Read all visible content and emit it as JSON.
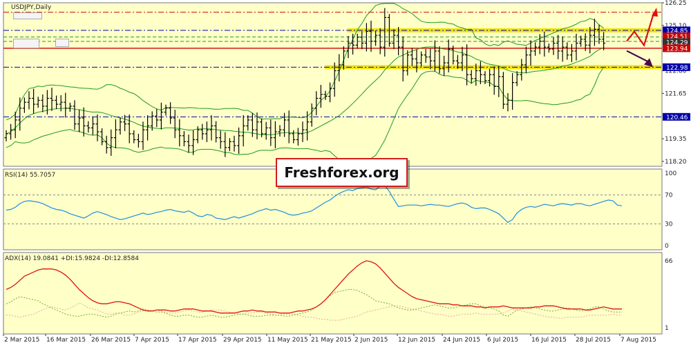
{
  "colors": {
    "background": "#ffffc8",
    "grid": "#d8d8a8",
    "candle": "#000000",
    "bollinger": "#1f9a1f",
    "rsi_line": "#1e8fe0",
    "adx_line": "#e01010",
    "di_plus": "#6fb02a",
    "di_minus": "#e6a8a8",
    "level_blue": "#0000aa",
    "level_red": "#cc0000",
    "zone_yellow": "#f0e000",
    "arrow_up": "#dd1010",
    "arrow_down": "#4b0a4b"
  },
  "header": {
    "symbol": "USDJPY,Daily"
  },
  "indicators": {
    "rsi_label": "RSI(14) 55.7057",
    "adx_label": "ADX(14) 19.0841 +DI:15.9824 -DI:12.8584"
  },
  "brand": {
    "text": "Freshforex.org"
  },
  "price_badges": [
    {
      "value": "124.85",
      "color": "#0000aa"
    },
    {
      "value": "124.51",
      "color": "#cc0000"
    },
    {
      "value": "124.29",
      "color": "#333333"
    },
    {
      "value": "123.94",
      "color": "#cc0000"
    },
    {
      "value": "122.98",
      "color": "#0000aa"
    },
    {
      "value": "120.46",
      "color": "#0000aa"
    }
  ],
  "chart_data": {
    "type": "candlestick",
    "title": "USDJPY,Daily",
    "x_tick_labels": [
      "2 Mar 2015",
      "16 Mar 2015",
      "26 Mar 2015",
      "7 Apr 2015",
      "17 Apr 2015",
      "29 Apr 2015",
      "11 May 2015",
      "21 May 2015",
      "2 Jun 2015",
      "12 Jun 2015",
      "24 Jun 2015",
      "6 Jul 2015",
      "16 Jul 2015",
      "28 Jul 2015",
      "7 Aug 2015"
    ],
    "price_axis": {
      "ylim": [
        117.95,
        126.25
      ],
      "tick_labels": [
        "126.25",
        "125.10",
        "122.80",
        "121.65",
        "119.35",
        "118.20"
      ]
    },
    "ohlc_close_estimates": [
      119.6,
      119.8,
      120.3,
      120.9,
      121.2,
      121.4,
      121.1,
      121.3,
      121.0,
      121.4,
      121.3,
      121.1,
      121.2,
      120.9,
      121.0,
      120.1,
      120.4,
      120.0,
      119.9,
      120.1,
      119.7,
      119.2,
      118.9,
      119.4,
      119.8,
      120.2,
      120.1,
      119.6,
      119.3,
      119.2,
      119.8,
      120.0,
      120.5,
      120.3,
      120.7,
      120.9,
      120.4,
      119.8,
      119.5,
      119.2,
      119.0,
      119.3,
      119.8,
      119.6,
      119.8,
      120.0,
      119.4,
      119.2,
      118.9,
      119.2,
      119.0,
      119.5,
      120.0,
      120.3,
      119.8,
      120.2,
      119.6,
      119.9,
      119.4,
      119.7,
      119.8,
      120.3,
      119.6,
      119.3,
      119.6,
      119.8,
      120.2,
      120.9,
      121.4,
      121.6,
      121.5,
      121.9,
      122.8,
      123.1,
      123.8,
      124.2,
      124.1,
      124.5,
      124.2,
      124.8,
      124.3,
      124.6,
      124.0,
      125.5,
      124.2,
      124.6,
      124.0,
      122.8,
      123.6,
      123.4,
      123.2,
      123.6,
      123.5,
      123.3,
      123.8,
      122.9,
      123.2,
      123.9,
      123.3,
      123.2,
      123.6,
      122.6,
      122.4,
      122.8,
      122.6,
      122.3,
      122.6,
      122.0,
      122.5,
      121.1,
      121.3,
      122.2,
      122.6,
      123.1,
      123.6,
      123.8,
      124.0,
      124.3,
      124.0,
      123.9,
      124.2,
      123.8,
      124.0,
      123.6,
      123.8,
      124.2,
      124.4,
      124.1,
      124.6,
      124.9,
      124.4,
      124.2
    ],
    "reference_levels": [
      {
        "price": 125.77,
        "style": "dash-dot",
        "color": "#cc0000"
      },
      {
        "price": 124.85,
        "style": "dash-dot",
        "color": "#0000aa"
      },
      {
        "price": 124.51,
        "style": "dash",
        "color": "#1f9a1f"
      },
      {
        "price": 124.29,
        "style": "dash",
        "color": "#1f9a1f"
      },
      {
        "price": 123.94,
        "style": "solid",
        "color": "#cc0000"
      },
      {
        "price": 122.98,
        "style": "dash-dot",
        "color": "#0000aa"
      },
      {
        "price": 120.46,
        "style": "dash-dot",
        "color": "#0000aa"
      }
    ],
    "rsi": {
      "label": "RSI(14) 55.7057",
      "ylim": [
        0,
        100
      ],
      "tick_labels": [
        "100",
        "70",
        "30",
        "0"
      ],
      "levels": [
        70,
        30
      ],
      "values": [
        49,
        50,
        53,
        58,
        61,
        62,
        61,
        60,
        58,
        55,
        52,
        50,
        49,
        47,
        44,
        42,
        40,
        38,
        41,
        45,
        47,
        45,
        43,
        40,
        38,
        36,
        37,
        39,
        41,
        43,
        45,
        43,
        44,
        46,
        47,
        49,
        50,
        48,
        47,
        46,
        48,
        45,
        41,
        40,
        43,
        42,
        38,
        37,
        36,
        38,
        40,
        38,
        40,
        42,
        44,
        47,
        49,
        51,
        49,
        50,
        48,
        46,
        43,
        42,
        43,
        45,
        46,
        48,
        52,
        56,
        60,
        63,
        68,
        72,
        75,
        77,
        76,
        79,
        80,
        81,
        78,
        77,
        82,
        83,
        75,
        64,
        54,
        55,
        56,
        56,
        56,
        55,
        56,
        57,
        56,
        56,
        55,
        54,
        56,
        58,
        59,
        57,
        53,
        51,
        52,
        52,
        50,
        47,
        44,
        38,
        32,
        36,
        45,
        50,
        53,
        54,
        53,
        55,
        57,
        56,
        55,
        57,
        58,
        57,
        56,
        58,
        58,
        56,
        55,
        57,
        59,
        61,
        63,
        62,
        56,
        55
      ]
    },
    "adx": {
      "label": "ADX(14) 19.0841 +DI:15.9824 -DI:12.8584",
      "tick_labels": [
        "66",
        "1"
      ],
      "adx": [
        38,
        40,
        43,
        47,
        51,
        53,
        55,
        57,
        58,
        58,
        58,
        57,
        55,
        52,
        48,
        43,
        38,
        34,
        30,
        27,
        25,
        24,
        24,
        25,
        26,
        26,
        25,
        24,
        22,
        20,
        18,
        17,
        17,
        18,
        18,
        18,
        17,
        17,
        18,
        19,
        19,
        19,
        18,
        17,
        17,
        17,
        16,
        15,
        15,
        15,
        15,
        16,
        17,
        17,
        18,
        17,
        17,
        16,
        16,
        16,
        15,
        15,
        15,
        16,
        17,
        17,
        18,
        19,
        21,
        24,
        28,
        33,
        38,
        43,
        48,
        53,
        57,
        61,
        64,
        66,
        65,
        63,
        59,
        54,
        49,
        44,
        40,
        37,
        34,
        31,
        29,
        28,
        27,
        26,
        25,
        24,
        24,
        24,
        23,
        23,
        22,
        22,
        22,
        21,
        21,
        20,
        21,
        21,
        21,
        22,
        21,
        20,
        20,
        20,
        20,
        20,
        21,
        21,
        22,
        22,
        22,
        21,
        20,
        19,
        19,
        19,
        19,
        18,
        18,
        19,
        20,
        21,
        20,
        19,
        19,
        19
      ],
      "di_plus": [
        24,
        26,
        29,
        31,
        30,
        29,
        28,
        27,
        24,
        22,
        20,
        18,
        16,
        14,
        13,
        12,
        12,
        13,
        14,
        14,
        13,
        12,
        11,
        12,
        14,
        15,
        16,
        17,
        16,
        17,
        19,
        18,
        17,
        16,
        16,
        15,
        13,
        12,
        12,
        13,
        13,
        12,
        11,
        11,
        12,
        13,
        12,
        11,
        11,
        12,
        13,
        14,
        14,
        13,
        12,
        12,
        12,
        13,
        13,
        13,
        13,
        12,
        12,
        13,
        14,
        15,
        16,
        18,
        21,
        24,
        28,
        32,
        35,
        36,
        37,
        38,
        38,
        37,
        35,
        33,
        30,
        27,
        26,
        25,
        24,
        22,
        20,
        19,
        18,
        18,
        19,
        20,
        21,
        22,
        23,
        22,
        21,
        20,
        20,
        21,
        22,
        23,
        24,
        24,
        22,
        21,
        20,
        19,
        17,
        13,
        12,
        15,
        18,
        19,
        20,
        21,
        20,
        19,
        18,
        17,
        17,
        18,
        19,
        20,
        19,
        18,
        17,
        18,
        19,
        21,
        21,
        19,
        17,
        16,
        16,
        16
      ],
      "di_minus": [
        13,
        13,
        12,
        11,
        12,
        13,
        14,
        16,
        18,
        20,
        21,
        20,
        19,
        18,
        20,
        22,
        25,
        23,
        20,
        19,
        18,
        16,
        14,
        14,
        15,
        15,
        13,
        13,
        14,
        16,
        17,
        18,
        17,
        18,
        17,
        16,
        15,
        15,
        16,
        17,
        18,
        17,
        16,
        16,
        17,
        18,
        18,
        18,
        17,
        16,
        15,
        14,
        14,
        15,
        15,
        16,
        16,
        15,
        14,
        13,
        13,
        14,
        14,
        14,
        13,
        12,
        11,
        11,
        10,
        9,
        9,
        8,
        8,
        8,
        9,
        10,
        11,
        12,
        14,
        16,
        17,
        18,
        19,
        20,
        21,
        22,
        22,
        21,
        20,
        19,
        18,
        17,
        16,
        15,
        14,
        14,
        13,
        12,
        12,
        13,
        14,
        14,
        14,
        15,
        14,
        14,
        14,
        14,
        14,
        15,
        17,
        19,
        18,
        17,
        16,
        15,
        14,
        13,
        12,
        11,
        11,
        10,
        10,
        11,
        11,
        11,
        11,
        12,
        13,
        13,
        13,
        13,
        13,
        14,
        13,
        13
      ]
    }
  }
}
